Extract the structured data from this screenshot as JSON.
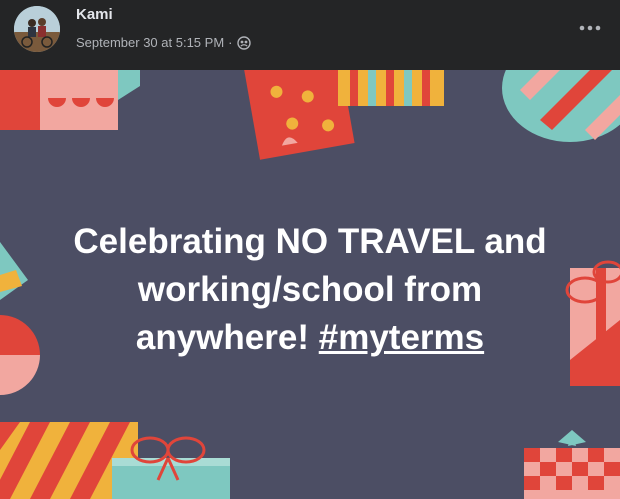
{
  "post": {
    "author": "Kami",
    "timestamp": "September 30 at 5:15 PM",
    "separator": "·",
    "audience_icon": "friends-icon",
    "more_icon": "more-options-icon"
  },
  "image": {
    "text_line1": "Celebrating NO TRAVEL and",
    "text_line2": "working/school from",
    "text_line3_prefix": "anywhere! ",
    "hashtag": "#myterms"
  },
  "colors": {
    "header_bg": "#242526",
    "name": "#e4e6eb",
    "meta": "#b0b3b8",
    "image_bg": "#4c4e64",
    "red": "#e0453a",
    "pink": "#f2a7a0",
    "teal": "#7ec8c0",
    "yellow": "#f0b23c"
  }
}
